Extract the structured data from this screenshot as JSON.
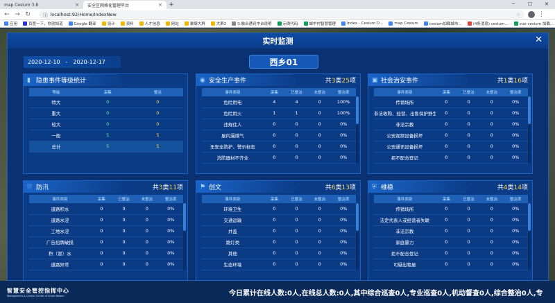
{
  "browser": {
    "tabs": [
      {
        "title": "map Cesium 3.8",
        "active": false
      },
      {
        "title": "安全区网格化管理平台",
        "active": true
      }
    ],
    "url": "localhost:92/Home/IndexNew",
    "bookmarks": [
      {
        "label": "应用",
        "color": "#4285f4"
      },
      {
        "label": "百度一下，你就知道",
        "color": "#2932e1"
      },
      {
        "label": "Google 翻译",
        "color": "#4285f4"
      },
      {
        "label": "设计",
        "color": "#f4b400"
      },
      {
        "label": "资料",
        "color": "#f4b400"
      },
      {
        "label": "人才信息",
        "color": "#f4b400"
      },
      {
        "label": "网站",
        "color": "#f4b400"
      },
      {
        "label": "暴爆大屏",
        "color": "#f4b400"
      },
      {
        "label": "大屏2",
        "color": "#f4b400"
      },
      {
        "label": "0.融合通讯中台说明",
        "color": "#888888"
      },
      {
        "label": "示例代码",
        "color": "#0f9d58"
      },
      {
        "label": "城中村智慧管理",
        "color": "#0f9d58"
      },
      {
        "label": "Index - Cesium D...",
        "color": "#4285f4"
      },
      {
        "label": "map Cesium",
        "color": "#4285f4"
      },
      {
        "label": "cesium加载城市...",
        "color": "#4285f4"
      },
      {
        "label": "(4条消息) cesium...",
        "color": "#db4437"
      },
      {
        "label": "vue cesium 加载...",
        "color": "#0f9d58"
      }
    ]
  },
  "modal": {
    "title": "实时监测",
    "date_start": "2020-12-10",
    "date_sep": "-",
    "date_end": "2020-12-17",
    "region": "西乡01"
  },
  "panels": {
    "hazard": {
      "title": "隐患事件等级统计",
      "icon": "bar-chart-icon",
      "headers": [
        "等级",
        "采集",
        "整治"
      ],
      "rows": [
        [
          "特大",
          "0",
          "0"
        ],
        [
          "重大",
          "0",
          "0"
        ],
        [
          "较大",
          "0",
          "0"
        ],
        [
          "一般",
          "5",
          "5"
        ],
        [
          "总计",
          "5",
          "5"
        ]
      ]
    },
    "safety": {
      "title": "安全生产事件",
      "icon": "eye-icon",
      "total_prefix": "共",
      "total_types": "3",
      "total_mid": "类",
      "total_items": "25",
      "total_suffix": "项",
      "headers": [
        "事件类别",
        "采集",
        "已整治",
        "未整治",
        "整治率"
      ],
      "rows": [
        [
          "危险用电",
          "4",
          "4",
          "0",
          "100%"
        ],
        [
          "危险用火",
          "1",
          "1",
          "0",
          "100%"
        ],
        [
          "违规住人",
          "0",
          "0",
          "0",
          "0%"
        ],
        [
          "屋内漏煤气",
          "0",
          "0",
          "0",
          "0%"
        ],
        [
          "无安全防护、警示标志",
          "0",
          "0",
          "0",
          "0%"
        ],
        [
          "消防器材不齐全",
          "0",
          "0",
          "0",
          "0%"
        ]
      ]
    },
    "public_security": {
      "title": "社会治安事件",
      "icon": "building-icon",
      "total_prefix": "共",
      "total_types": "1",
      "total_mid": "类",
      "total_items": "16",
      "total_suffix": "项",
      "headers": [
        "事件类别",
        "采集",
        "已整治",
        "未整治",
        "整治率"
      ],
      "rows": [
        [
          "传销场所",
          "0",
          "0",
          "0",
          "0%"
        ],
        [
          "非法收购、经营、出售保护野生动物",
          "0",
          "0",
          "0",
          "0%"
        ],
        [
          "非法宗教",
          "0",
          "0",
          "0",
          "0%"
        ],
        [
          "公安视频设备损坏",
          "0",
          "0",
          "0",
          "0%"
        ],
        [
          "公安通讯设备损坏",
          "0",
          "0",
          "0",
          "0%"
        ],
        [
          "拒不配合登记",
          "0",
          "0",
          "0",
          "0%"
        ]
      ]
    },
    "flood": {
      "title": "防汛",
      "icon": "flood-icon",
      "total_prefix": "共",
      "total_types": "3",
      "total_mid": "类",
      "total_items": "11",
      "total_suffix": "项",
      "headers": [
        "事件类别",
        "采集",
        "已整治",
        "未整治",
        "整治率"
      ],
      "rows": [
        [
          "道路积水",
          "0",
          "0",
          "0",
          "0%"
        ],
        [
          "道路水浸",
          "0",
          "0",
          "0",
          "0%"
        ],
        [
          "工地水浸",
          "0",
          "0",
          "0",
          "0%"
        ],
        [
          "广告招牌破损",
          "0",
          "0",
          "0",
          "0%"
        ],
        [
          "积（冒）水",
          "0",
          "0",
          "0",
          "0%"
        ],
        [
          "道路异常",
          "0",
          "0",
          "0",
          "0%"
        ]
      ]
    },
    "civilization": {
      "title": "创文",
      "icon": "flag-icon",
      "total_prefix": "共",
      "total_types": "6",
      "total_mid": "类",
      "total_items": "13",
      "total_suffix": "项",
      "headers": [
        "事件类别",
        "采集",
        "已整治",
        "未整治",
        "整治率"
      ],
      "rows": [
        [
          "环境卫生",
          "0",
          "0",
          "0",
          "0%"
        ],
        [
          "交通运输",
          "0",
          "0",
          "0",
          "0%"
        ],
        [
          "井盖",
          "0",
          "0",
          "0",
          "0%"
        ],
        [
          "路灯类",
          "0",
          "0",
          "0",
          "0%"
        ],
        [
          "其他",
          "0",
          "0",
          "0",
          "0%"
        ],
        [
          "生态环境",
          "0",
          "0",
          "0",
          "0%"
        ]
      ]
    },
    "stability": {
      "title": "维稳",
      "icon": "shield-icon",
      "total_prefix": "共",
      "total_types": "4",
      "total_mid": "类",
      "total_items": "14",
      "total_suffix": "项",
      "headers": [
        "事件类别",
        "采集",
        "已整治",
        "未整治",
        "整治率"
      ],
      "rows": [
        [
          "传销场所",
          "0",
          "0",
          "0",
          "0%"
        ],
        [
          "法定代表人或经营者失联",
          "0",
          "0",
          "0",
          "0%"
        ],
        [
          "非法宗教",
          "0",
          "0",
          "0",
          "0%"
        ],
        [
          "家庭暴力",
          "0",
          "0",
          "0",
          "0%"
        ],
        [
          "拒不配合登记",
          "0",
          "0",
          "0",
          "0%"
        ],
        [
          "可疑出租屋",
          "0",
          "0",
          "0",
          "0%"
        ]
      ]
    }
  },
  "footer": {
    "logo_cn": "智慧安全管控指挥中心",
    "logo_en": "Management & Control Center of Smart Bawan",
    "ticker": "今日累计在线人数:0人,在线总人数:0人,其中综合巡查0人,专业巡查0人,机动督查0人,综合整治0人,专"
  },
  "colors": {
    "accent_yellow": "#ffd23f",
    "accent_green": "#54f28a",
    "panel_bg": "#0c3b86"
  }
}
